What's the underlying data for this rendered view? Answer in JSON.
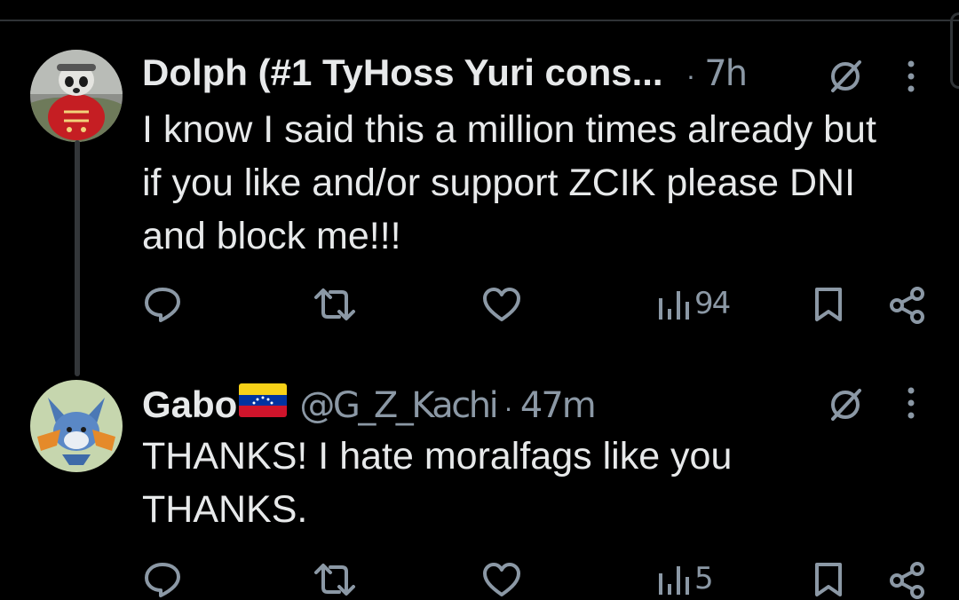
{
  "tweets": [
    {
      "display_name": "Dolph (#1 TyHoss Yuri cons...",
      "separator": "·",
      "time": "7h",
      "text": "I know I said this a million times already but\nif you like and/or support ZCIK please DNI\nand block me!!!",
      "views": "94",
      "avatar": "lemur-avatar"
    },
    {
      "display_name": "Gabo",
      "flag": "venezuela-flag",
      "handle": "@G_Z_Kachi",
      "separator": "·",
      "time": "47m",
      "text": "THANKS! I hate moralfags like you\nTHANKS.",
      "views": "5",
      "avatar": "pokemon-avatar"
    }
  ],
  "icons": [
    "reply-icon",
    "retweet-icon",
    "like-icon",
    "views-icon",
    "bookmark-icon",
    "share-icon",
    "grok-icon",
    "more-icon"
  ],
  "colors": {
    "background": "#000000",
    "text": "#e7e9ea",
    "muted": "#8b98a5",
    "thread_line": "#333639"
  }
}
